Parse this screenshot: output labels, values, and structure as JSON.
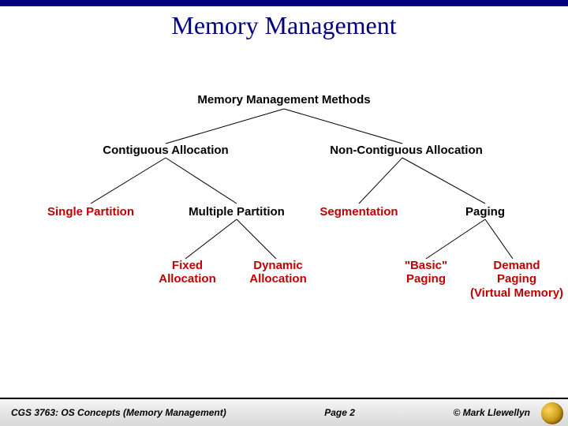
{
  "title": "Memory Management",
  "tree": {
    "root": "Memory Management Methods",
    "level1": {
      "left": "Contiguous Allocation",
      "right": "Non-Contiguous Allocation"
    },
    "level2": {
      "l1": "Single Partition",
      "l2": "Multiple Partition",
      "r1": "Segmentation",
      "r2": "Paging"
    },
    "level3": {
      "mp1": "Fixed\nAllocation",
      "mp2": "Dynamic\nAllocation",
      "pg1": "\"Basic\"\nPaging",
      "pg2": "Demand\nPaging\n(Virtual Memory)"
    }
  },
  "footer": {
    "left": "CGS 3763: OS Concepts (Memory Management)",
    "center": "Page 2",
    "right": "© Mark Llewellyn"
  }
}
